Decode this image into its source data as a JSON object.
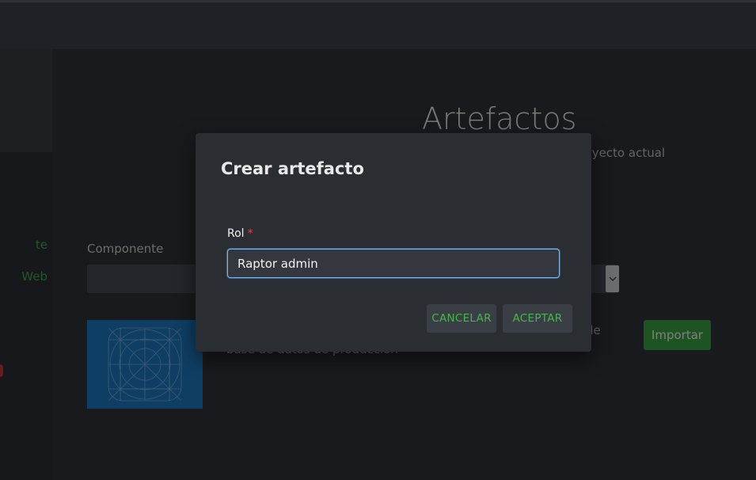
{
  "sidebar": {
    "links": [
      "te",
      "Web"
    ]
  },
  "page": {
    "title": "Artefactos",
    "subtitle_fragment": "el proyecto actual",
    "component_label": "Componente",
    "card_desc_fragment_a": "de",
    "card_desc_fragment_b": "base de datos de producción",
    "import_label": "Importar"
  },
  "dialog": {
    "title": "Crear artefacto",
    "role_label": "Rol",
    "required_marker": "*",
    "role_value": "Raptor admin",
    "cancel_label": "CANCELAR",
    "accept_label": "ACEPTAR"
  },
  "colors": {
    "accent_green": "#49b54f",
    "focus_blue": "#7fb6ec",
    "required_red": "#e04848"
  },
  "icons": [
    "chevron-down-icon",
    "app-icon-grid-blueprint"
  ]
}
